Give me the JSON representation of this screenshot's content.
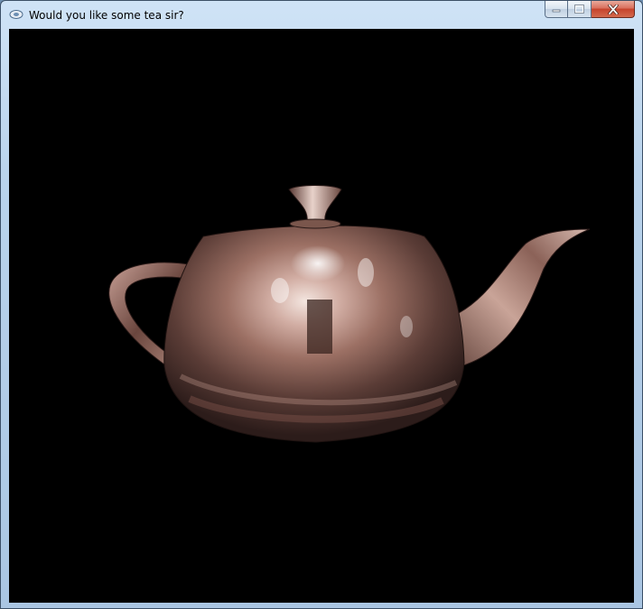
{
  "window": {
    "title": "Would you like some tea sir?",
    "app_icon": "opengl-app-icon",
    "controls": [
      "minimize-icon",
      "maximize-icon",
      "close-icon"
    ]
  },
  "scene": {
    "background_color": "#000000",
    "object": "teapot",
    "material": "reflective copper environment-mapped"
  }
}
